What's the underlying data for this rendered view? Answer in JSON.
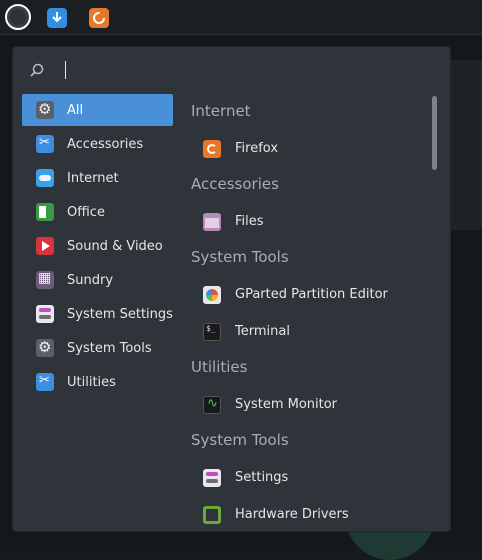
{
  "search": {
    "placeholder": ""
  },
  "categories": [
    {
      "label": "All",
      "icon": "gear-icon",
      "active": true
    },
    {
      "label": "Accessories",
      "icon": "tools-icon"
    },
    {
      "label": "Internet",
      "icon": "cloud-icon"
    },
    {
      "label": "Office",
      "icon": "office-icon"
    },
    {
      "label": "Sound & Video",
      "icon": "video-icon"
    },
    {
      "label": "Sundry",
      "icon": "sundry-icon"
    },
    {
      "label": "System Settings",
      "icon": "settings-toggle-icon"
    },
    {
      "label": "System Tools",
      "icon": "gear-icon"
    },
    {
      "label": "Utilities",
      "icon": "tools-icon"
    }
  ],
  "apps": {
    "section_internet": "Internet",
    "firefox": "Firefox",
    "section_accessories": "Accessories",
    "files": "Files",
    "section_system_tools": "System Tools",
    "gparted": "GParted Partition Editor",
    "terminal": "Terminal",
    "section_utilities": "Utilities",
    "system_monitor": "System Monitor",
    "section_system_tools_2": "System Tools",
    "settings": "Settings",
    "hardware_drivers": "Hardware Drivers"
  },
  "colors": {
    "accent": "#4a90d9",
    "menu_bg": "#2f333a",
    "section_text": "#a9adb3"
  }
}
